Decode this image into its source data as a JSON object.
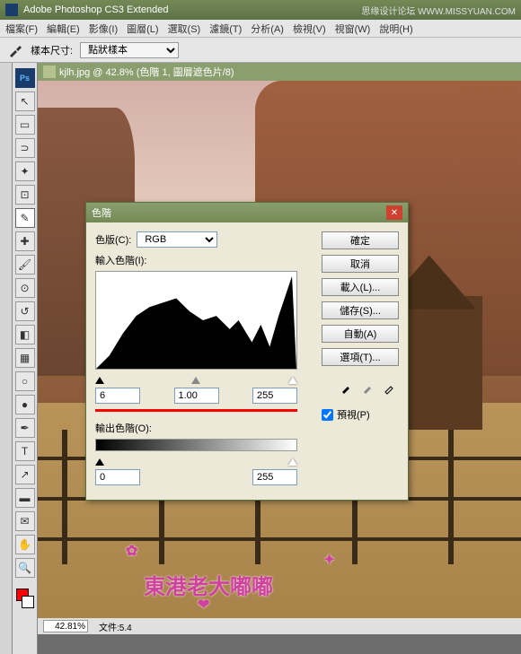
{
  "app": {
    "title": "Adobe Photoshop CS3 Extended",
    "watermark_text": "思缘设计论坛 WWW.MISSYUAN.COM"
  },
  "menu": [
    "檔案(F)",
    "編輯(E)",
    "影像(I)",
    "圖層(L)",
    "選取(S)",
    "濾鏡(T)",
    "分析(A)",
    "檢視(V)",
    "視窗(W)",
    "說明(H)"
  ],
  "options": {
    "sample_label": "樣本尺寸:",
    "sample_value": "點狀樣本"
  },
  "document": {
    "title": "kjlh.jpg @ 42.8% (色階 1, 圖層遮色片/8)",
    "zoom": "42.81%",
    "filesize_label": "文件:5.4"
  },
  "dialog": {
    "title": "色階",
    "channel_label": "色版(C):",
    "channel_value": "RGB",
    "input_label": "輸入色階(I):",
    "output_label": "輸出色階(O):",
    "in_black": "6",
    "in_gamma": "1.00",
    "in_white": "255",
    "out_black": "0",
    "out_white": "255",
    "buttons": {
      "ok": "確定",
      "cancel": "取消",
      "load": "載入(L)...",
      "save": "儲存(S)...",
      "auto": "自動(A)",
      "options": "選項(T)..."
    },
    "preview_label": "預視(P)"
  },
  "watermark_stamp": "東港老大嘟嘟"
}
